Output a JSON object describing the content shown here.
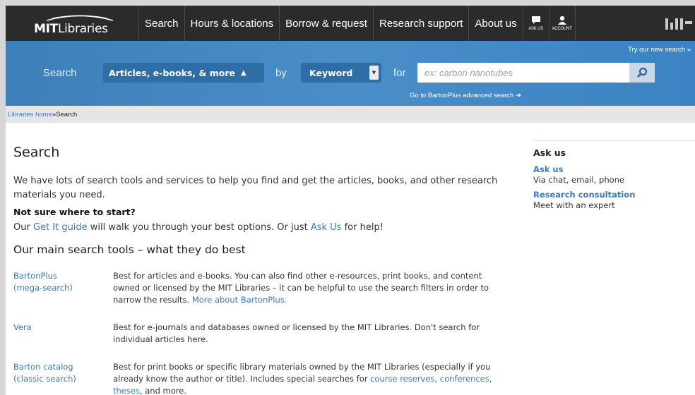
{
  "header": {
    "logo_bold": "MIT",
    "logo_rest": "Libraries",
    "nav": [
      "Search",
      "Hours & locations",
      "Borrow & request",
      "Research support",
      "About us"
    ],
    "ask_label": "ASK US",
    "account_label": "ACCOUNT"
  },
  "search": {
    "try_new": "Try our new search »",
    "search_word": "Search",
    "source_value": "Articles, e-books, & more",
    "by_word": "by",
    "field_value": "Keyword",
    "for_word": "for",
    "placeholder": "ex: carbon nanotubes",
    "advanced_link": "Go to BartonPlus advanced search"
  },
  "breadcrumb": {
    "home": "Libraries home",
    "separator": " » ",
    "current": "Search"
  },
  "main": {
    "title": "Search",
    "intro": "We have lots of search tools and services to help you find and get the articles, books, and other research materials you need.",
    "unsure_heading": "Not sure where to start?",
    "unsure_pre": "Our ",
    "get_it_link": "Get It guide",
    "unsure_mid": " will walk you through your best options. Or just ",
    "ask_us_link": "Ask Us",
    "unsure_post": " for help!",
    "tools_heading": "Our main search tools – what they do best",
    "tools": [
      {
        "name_line1": "BartonPlus",
        "name_line2": "(mega-search)",
        "desc": "Best for articles and e-books. You can also find other e-resources, print books, and content owned or licensed by the MIT Libraries – it can be helpful to use the search filters in order to narrow the results. ",
        "desc_link": "More about BartonPlus."
      },
      {
        "name_line1": "Vera",
        "name_line2": "",
        "desc": "Best for e-journals and databases owned or licensed by the MIT Libraries. Don't search for individual articles here.",
        "desc_link": ""
      },
      {
        "name_line1": "Barton catalog",
        "name_line2": "(classic search)",
        "desc": "Best for print books or specific library materials owned by the MIT Libraries (especially if you already know the author or title). Includes special searches for ",
        "link1": "course reserves",
        "sep1": ", ",
        "link2": "conferences",
        "sep2": ", ",
        "link3": "theses",
        "tail": ", and more."
      }
    ]
  },
  "sidebar": {
    "heading": "Ask us",
    "items": [
      {
        "title": "Ask us",
        "sub": "Via chat, email, phone"
      },
      {
        "title": "Research consultation",
        "sub": "Meet with an expert"
      }
    ]
  },
  "colors": {
    "topbar": "#2b2b2b",
    "search_band": "#4a8ec9",
    "link": "#3a7bbf",
    "select_bg": "#2f6da7"
  }
}
